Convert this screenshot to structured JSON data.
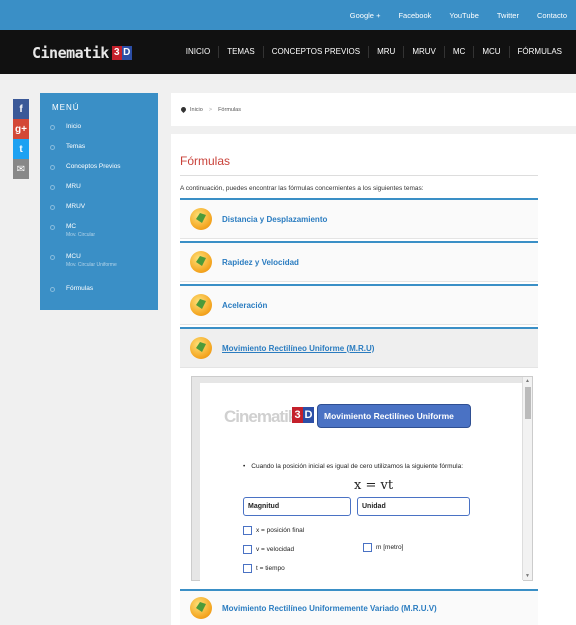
{
  "top_links": [
    "Google +",
    "Facebook",
    "YouTube",
    "Twitter",
    "Contacto"
  ],
  "logo": {
    "text": "Cinematik",
    "digit": "3",
    "letter": "D"
  },
  "main_nav": [
    "INICIO",
    "TEMAS",
    "CONCEPTOS PREVIOS",
    "MRU",
    "MRUV",
    "MC",
    "MCU",
    "FÓRMULAS"
  ],
  "social": {
    "facebook": "f",
    "googleplus": "g+",
    "twitter": "t",
    "mail": "✉"
  },
  "sidebar": {
    "title": "MENÚ",
    "items": [
      {
        "label": "Inicio",
        "sub": ""
      },
      {
        "label": "Temas",
        "sub": ""
      },
      {
        "label": "Conceptos Previos",
        "sub": ""
      },
      {
        "label": "MRU",
        "sub": ""
      },
      {
        "label": "MRUV",
        "sub": ""
      },
      {
        "label": "MC",
        "sub": "Mov. Circular"
      },
      {
        "label": "MCU",
        "sub": "Mov. Circular Uniforme"
      },
      {
        "label": "Fórmulas",
        "sub": ""
      }
    ]
  },
  "breadcrumb": {
    "home": "Inicio",
    "sep": ">",
    "current": "Fórmulas"
  },
  "page": {
    "title": "Fórmulas",
    "intro": "A continuación, puedes encontrar las fórmulas concernientes a los siguientes temas:"
  },
  "accordion": [
    "Distancia y Desplazamiento",
    "Rapidez y Velocidad",
    "Aceleración",
    "Movimiento Rectilíneo Uniforme (M.R.U)",
    "Movimiento Rectilíneo Uniformemente Variado (M.R.U.V)"
  ],
  "document": {
    "logo_text": "Cinematik",
    "banner": "Movimiento Rectilíneo Uniforme",
    "bullet": "Cuando la posición inicial es igual de cero utilizamos la siguiente fórmula:",
    "formula": "x = vt",
    "col1": "Magnitud",
    "col2": "Unidad",
    "items": [
      "x = posición final",
      "v = velocidad",
      "t = tiempo"
    ],
    "unit_item": "m   [metro]"
  }
}
